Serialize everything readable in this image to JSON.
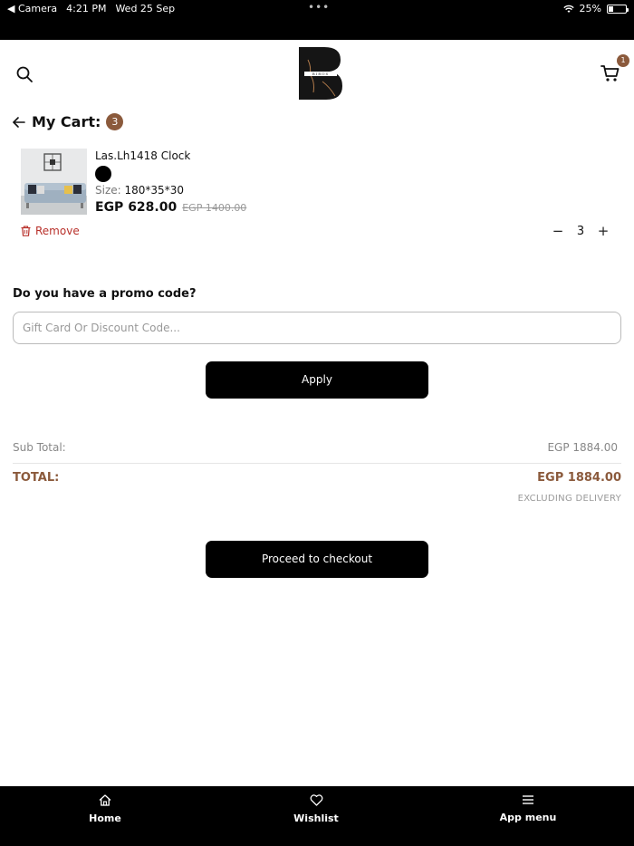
{
  "status_bar": {
    "back_app": "◀ Camera",
    "time": "4:21 PM",
    "date": "Wed 25 Sep",
    "battery": "25%",
    "battery_level": 0.25
  },
  "header": {
    "logo_text": "BIROS",
    "cart_count": "1"
  },
  "cart": {
    "title": "My Cart:",
    "count": "3",
    "items": [
      {
        "name": "Las.Lh1418 Clock",
        "color_swatch": "#000000",
        "size_label": "Size:",
        "size_value": "180*35*30",
        "price": "EGP 628.00",
        "old_price": "EGP 1400.00",
        "remove_label": "Remove",
        "quantity": "3"
      }
    ]
  },
  "promo": {
    "label": "Do you have a promo code?",
    "placeholder": "Gift Card Or Discount Code...",
    "apply_label": "Apply"
  },
  "summary": {
    "subtotal_label": "Sub Total:",
    "subtotal_value": "EGP 1884.00",
    "total_label": "TOTAL:",
    "total_value": "EGP 1884.00",
    "note": "EXCLUDING DELIVERY",
    "checkout_label": "Proceed to checkout"
  },
  "tabbar": {
    "home": "Home",
    "wishlist": "Wishlist",
    "menu": "App menu"
  },
  "colors": {
    "accent": "#8b5a3c",
    "remove": "#b8302a",
    "button": "#000000"
  }
}
